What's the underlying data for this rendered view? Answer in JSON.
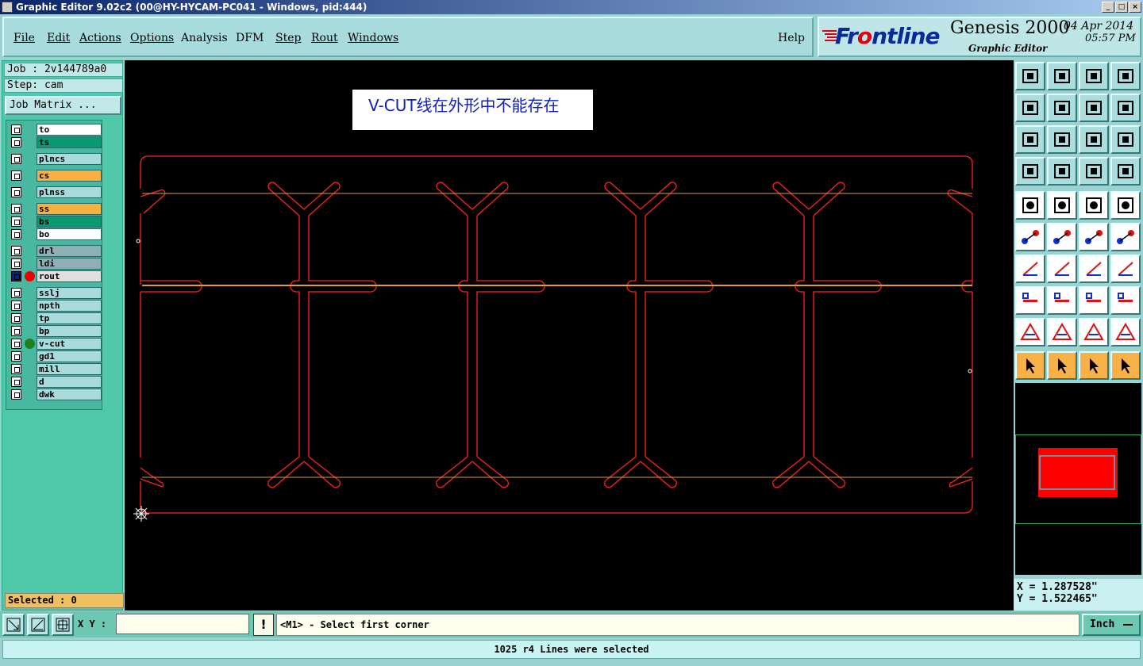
{
  "window": {
    "title": "Graphic Editor 9.02c2 (00@HY-HYCAM-PC041 - Windows, pid:444)"
  },
  "menu": {
    "file": "File",
    "edit": "Edit",
    "actions": "Actions",
    "options": "Options",
    "analysis": "Analysis",
    "dfm": "DFM",
    "step": "Step",
    "rout": "Rout",
    "windows": "Windows",
    "help": "Help"
  },
  "brand": {
    "logo": "Frontline",
    "product": "Genesis 2000",
    "subtitle": "Graphic Editor",
    "date": "04 Apr 2014",
    "time": "05:57 PM"
  },
  "job": {
    "job": "Job : 2v144789a0",
    "step": "Step: cam",
    "matrix": "Job Matrix ..."
  },
  "layers": [
    {
      "name": "to",
      "color": "#ffffff"
    },
    {
      "name": "ts",
      "color": "#0a9a70"
    },
    {
      "name": "plncs",
      "color": "#a8dcdc"
    },
    {
      "name": "cs",
      "color": "#f8b040"
    },
    {
      "name": "plnss",
      "color": "#a8dcdc"
    },
    {
      "name": "ss",
      "color": "#f8b040"
    },
    {
      "name": "bs",
      "color": "#0a9a70"
    },
    {
      "name": "bo",
      "color": "#ffffff"
    },
    {
      "name": "drl",
      "color": "#90b0b8"
    },
    {
      "name": "ldi",
      "color": "#90b0b8"
    },
    {
      "name": "rout",
      "color": "#e0e0e0",
      "dot": "#ee0000",
      "work": true
    },
    {
      "name": "sslj",
      "color": "#a8dcdc"
    },
    {
      "name": "npth",
      "color": "#a8dcdc"
    },
    {
      "name": "tp",
      "color": "#a8dcdc"
    },
    {
      "name": "bp",
      "color": "#a8dcdc"
    },
    {
      "name": "v-cut",
      "color": "#a8dcdc",
      "dot": "#208020"
    },
    {
      "name": "gd1",
      "color": "#a8dcdc"
    },
    {
      "name": "mill",
      "color": "#a8dcdc"
    },
    {
      "name": "d",
      "color": "#a8dcdc"
    },
    {
      "name": "dwk",
      "color": "#a8dcdc"
    }
  ],
  "selected": "Selected : 0",
  "annotation": "V-CUT线在外形中不能存在",
  "coords": {
    "x": "X = 1.287528\"",
    "y": "Y = 1.522465\""
  },
  "bottom": {
    "xy_label": "X Y :",
    "xy_value": "",
    "prompt": "<M1> - Select first corner",
    "unit": "Inch"
  },
  "status": "1025 r4 Lines were selected",
  "colors": {
    "rout": "#ff2020",
    "vcut": "#d4a040",
    "canvas": "#000000"
  }
}
